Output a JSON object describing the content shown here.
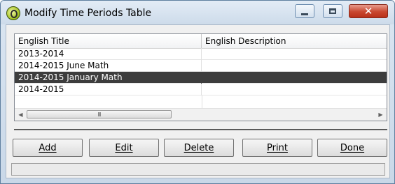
{
  "window": {
    "title": "Modify Time Periods Table",
    "controls": {
      "minimize": "minimize-icon",
      "maximize": "maximize-icon",
      "close": "close-icon"
    }
  },
  "table": {
    "columns": [
      "English Title",
      "English Description"
    ],
    "rows": [
      {
        "title": "2013-2014",
        "description": "",
        "selected": false
      },
      {
        "title": "2014-2015 June Math",
        "description": "",
        "selected": false
      },
      {
        "title": "2014-2015 January Math",
        "description": "",
        "selected": true
      },
      {
        "title": "2014-2015",
        "description": "",
        "selected": false
      }
    ],
    "scrollbar": {
      "grip": "III",
      "left_arrow": "◀",
      "right_arrow": "▶"
    }
  },
  "buttons": {
    "add": "Add",
    "edit": "Edit",
    "delete": "Delete",
    "print": "Print",
    "done": "Done"
  },
  "status": {
    "text": ""
  },
  "colors": {
    "selected_row": "#3d3d3d",
    "close_button": "#c9472f"
  }
}
